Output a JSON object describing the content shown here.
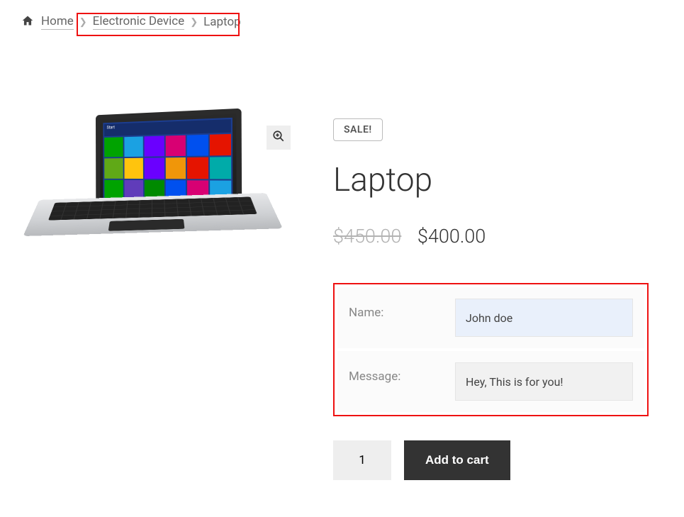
{
  "breadcrumb": {
    "home": "Home",
    "category": "Electronic Device",
    "current": "Laptop"
  },
  "product": {
    "sale_badge": "SALE!",
    "title": "Laptop",
    "price_old": "$450.00",
    "price_new": "$400.00"
  },
  "gift_fields": {
    "name_label": "Name:",
    "name_value": "John doe",
    "message_label": "Message:",
    "message_value": "Hey, This is for you!"
  },
  "cart": {
    "qty": "1",
    "add_label": "Add to cart"
  },
  "screen_start_label": "Start"
}
